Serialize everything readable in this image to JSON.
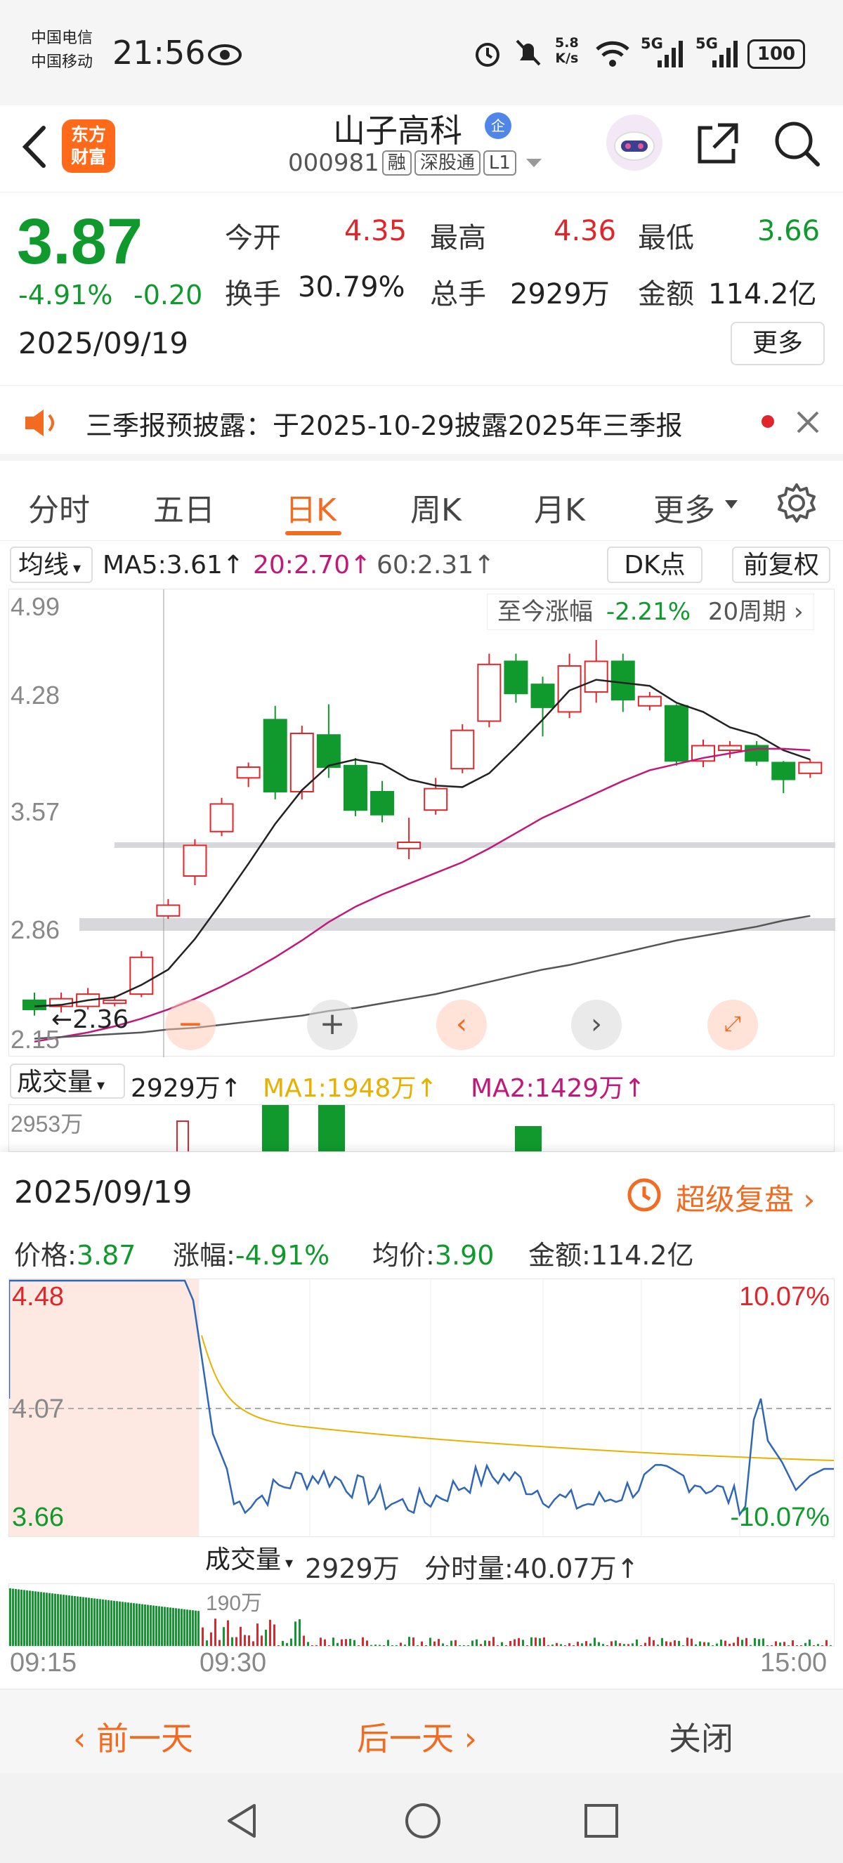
{
  "status": {
    "carrier1": "中国电信",
    "carrier2": "中国移动",
    "time": "21:56",
    "net_speed_top": "5.8",
    "net_speed_unit": "K/s",
    "signal1": "5G",
    "signal2": "5G",
    "battery": "100"
  },
  "header": {
    "logo_top": "东方",
    "logo_bottom": "财富",
    "name": "山子高科",
    "name_badge": "企",
    "code": "000981",
    "tags": [
      "融",
      "深股通",
      "L1"
    ]
  },
  "quote": {
    "price": "3.87",
    "change_pct": "-4.91%",
    "change_abs": "-0.20",
    "date": "2025/09/19",
    "open_label": "今开",
    "open": "4.35",
    "high_label": "最高",
    "high": "4.36",
    "low_label": "最低",
    "low": "3.66",
    "turnover_label": "换手",
    "turnover": "30.79%",
    "volume_label": "总手",
    "volume": "2929万",
    "amount_label": "金额",
    "amount": "114.2亿",
    "more": "更多"
  },
  "notice": {
    "text": "三季报预披露：于2025-10-29披露2025年三季报"
  },
  "tabs": [
    {
      "label": "分时"
    },
    {
      "label": "五日"
    },
    {
      "label": "日K"
    },
    {
      "label": "周K"
    },
    {
      "label": "月K"
    },
    {
      "label": "更多"
    }
  ],
  "kchart": {
    "ma_selector": "均线",
    "ma5": "MA5:3.61",
    "ma20": "20:2.70",
    "ma60": "60:2.31",
    "dk": "DK点",
    "adjust": "前复权",
    "period_info_label": "至今涨幅",
    "period_info_value": "-2.21%",
    "period_info_period": "20周期",
    "y_ticks": [
      "4.99",
      "4.28",
      "3.57",
      "2.86",
      "2.15"
    ],
    "min_marker": "2.36",
    "volume_selector": "成交量",
    "volume_value": "2929万",
    "vol_ma1": "MA1:1948万",
    "vol_ma2": "MA2:1429万",
    "vol_max": "2953万"
  },
  "chart_data": {
    "type": "candlestick",
    "ylim": [
      2.15,
      4.99
    ],
    "candles": [
      {
        "o": 2.43,
        "c": 2.37,
        "h": 2.48,
        "l": 2.33
      },
      {
        "o": 2.39,
        "c": 2.44,
        "h": 2.48,
        "l": 2.35
      },
      {
        "o": 2.39,
        "c": 2.47,
        "h": 2.51,
        "l": 2.37
      },
      {
        "o": 2.41,
        "c": 2.43,
        "h": 2.46,
        "l": 2.39
      },
      {
        "o": 2.47,
        "c": 2.71,
        "h": 2.75,
        "l": 2.45
      },
      {
        "o": 2.98,
        "c": 3.05,
        "h": 3.09,
        "l": 2.96
      },
      {
        "o": 3.24,
        "c": 3.44,
        "h": 3.48,
        "l": 3.18
      },
      {
        "o": 3.53,
        "c": 3.71,
        "h": 3.75,
        "l": 3.5
      },
      {
        "o": 3.88,
        "c": 3.95,
        "h": 3.98,
        "l": 3.82
      },
      {
        "o": 4.26,
        "c": 3.79,
        "h": 4.35,
        "l": 3.74
      },
      {
        "o": 3.79,
        "c": 4.17,
        "h": 4.22,
        "l": 3.74
      },
      {
        "o": 4.16,
        "c": 3.95,
        "h": 4.36,
        "l": 3.88
      },
      {
        "o": 3.96,
        "c": 3.67,
        "h": 4.01,
        "l": 3.63
      },
      {
        "o": 3.79,
        "c": 3.64,
        "h": 3.86,
        "l": 3.59
      },
      {
        "o": 3.42,
        "c": 3.46,
        "h": 3.62,
        "l": 3.35
      },
      {
        "o": 3.67,
        "c": 3.81,
        "h": 3.88,
        "l": 3.64
      },
      {
        "o": 3.94,
        "c": 4.19,
        "h": 4.23,
        "l": 3.91
      },
      {
        "o": 4.25,
        "c": 4.62,
        "h": 4.69,
        "l": 4.21
      },
      {
        "o": 4.64,
        "c": 4.43,
        "h": 4.69,
        "l": 4.37
      },
      {
        "o": 4.49,
        "c": 4.34,
        "h": 4.54,
        "l": 4.15
      },
      {
        "o": 4.31,
        "c": 4.61,
        "h": 4.69,
        "l": 4.27
      },
      {
        "o": 4.44,
        "c": 4.64,
        "h": 4.78,
        "l": 4.37
      },
      {
        "o": 4.64,
        "c": 4.39,
        "h": 4.69,
        "l": 4.31
      },
      {
        "o": 4.35,
        "c": 4.41,
        "h": 4.44,
        "l": 4.32
      },
      {
        "o": 4.35,
        "c": 3.99,
        "h": 4.36,
        "l": 3.96
      },
      {
        "o": 3.99,
        "c": 4.09,
        "h": 4.13,
        "l": 3.95
      },
      {
        "o": 4.06,
        "c": 4.09,
        "h": 4.12,
        "l": 4.01
      },
      {
        "o": 4.09,
        "c": 3.99,
        "h": 4.12,
        "l": 3.96
      },
      {
        "o": 3.98,
        "c": 3.87,
        "h": 3.99,
        "l": 3.78
      },
      {
        "o": 3.91,
        "c": 3.98,
        "h": 4.0,
        "l": 3.88
      }
    ],
    "ma5": [
      2.39,
      2.4,
      2.43,
      2.45,
      2.53,
      2.63,
      2.83,
      3.07,
      3.32,
      3.58,
      3.8,
      3.96,
      4.0,
      3.97,
      3.87,
      3.83,
      3.82,
      3.91,
      4.08,
      4.26,
      4.45,
      4.52,
      4.5,
      4.48,
      4.37,
      4.31,
      4.21,
      4.16,
      4.06,
      4.0
    ],
    "ma20": [
      2.16,
      2.19,
      2.22,
      2.26,
      2.31,
      2.37,
      2.44,
      2.52,
      2.61,
      2.71,
      2.82,
      2.94,
      3.04,
      3.12,
      3.19,
      3.26,
      3.33,
      3.42,
      3.52,
      3.62,
      3.7,
      3.78,
      3.86,
      3.93,
      3.97,
      4.01,
      4.04,
      4.07,
      4.07,
      4.06
    ],
    "ma60": [
      2.18,
      2.19,
      2.2,
      2.21,
      2.22,
      2.24,
      2.25,
      2.27,
      2.29,
      2.31,
      2.33,
      2.36,
      2.38,
      2.41,
      2.44,
      2.47,
      2.51,
      2.55,
      2.59,
      2.63,
      2.66,
      2.7,
      2.74,
      2.78,
      2.82,
      2.85,
      2.88,
      2.91,
      2.95,
      2.98
    ]
  },
  "panel": {
    "date": "2025/09/19",
    "replay": "超级复盘",
    "price_label": "价格:",
    "price": "3.87",
    "chg_label": "涨幅:",
    "chg": "-4.91%",
    "avg_label": "均价:",
    "avg": "3.90",
    "amt_label": "金额:",
    "amt": "114.2亿",
    "y_top": "4.48",
    "y_mid": "4.07",
    "y_bot": "3.66",
    "pct_top": "10.07%",
    "pct_bot": "-10.07%",
    "vol_selector": "成交量",
    "vol_total": "2929万",
    "vol_minute_label": "分时量:",
    "vol_minute": "40.07万",
    "vol_axis": "190万",
    "time_start": "09:15",
    "time_open": "09:30",
    "time_end": "15:00",
    "prev": "前一天",
    "next": "后一天",
    "close": "关闭"
  }
}
